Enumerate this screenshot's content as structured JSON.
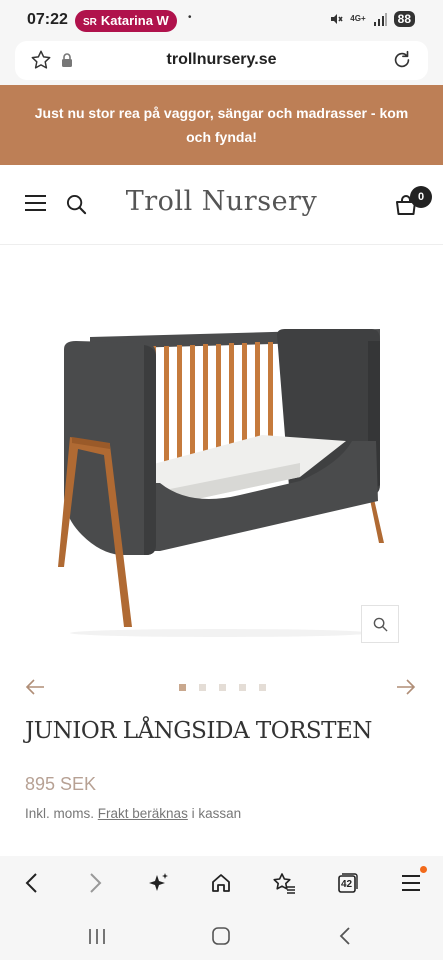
{
  "status_bar": {
    "time": "07:22",
    "caller_name": "Katarina W",
    "caller_app_mark": "SR",
    "dot": "•",
    "network": "4G+",
    "battery": "88"
  },
  "browser": {
    "url": "trollnursery.se",
    "tab_count": "42"
  },
  "promo": {
    "text": "Just nu stor rea på vaggor, sängar och madrasser - kom och fynda!"
  },
  "site": {
    "brand": "Troll Nursery",
    "cart_count": "0"
  },
  "product": {
    "title": "JUNIOR LÅNGSIDA TORSTEN",
    "price": "895 SEK",
    "vat_prefix": "Inkl. moms.",
    "shipping_link": "Frakt beräknas",
    "vat_suffix": "i kassan",
    "gallery": {
      "slides": 5,
      "active_index": 0
    }
  },
  "colors": {
    "promo_bg": "#bd7f56",
    "price": "#b7a194",
    "crib_body": "#4a4b4c",
    "wood": "#b06a33",
    "caller_pill": "#b0124c"
  },
  "icons": [
    "star-icon",
    "lock-icon",
    "reload-icon",
    "menu-icon",
    "search-icon",
    "cart-icon",
    "zoom-icon",
    "arrow-left-icon",
    "arrow-right-icon",
    "back-icon",
    "forward-icon",
    "sparkle-icon",
    "home-icon",
    "bookmarks-icon",
    "tabs-icon",
    "browser-menu-icon"
  ]
}
